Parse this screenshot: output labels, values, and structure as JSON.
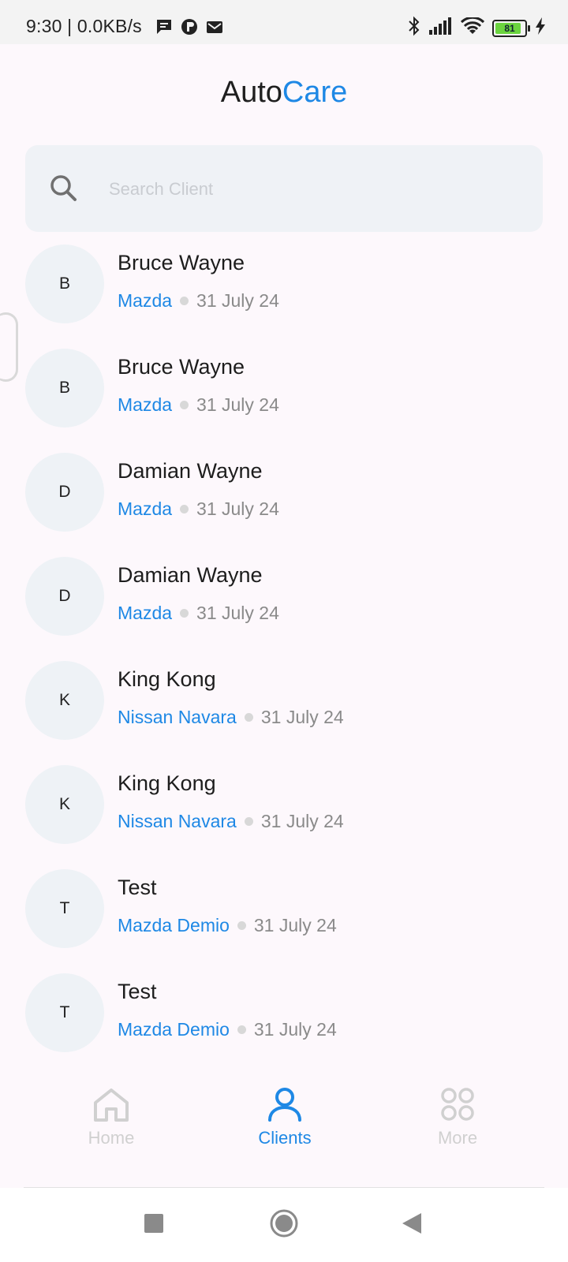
{
  "status_bar": {
    "time": "9:30 | 0.0KB/s",
    "battery": "81",
    "icons": [
      "message-icon",
      "app-icon",
      "mail-icon",
      "bluetooth-icon",
      "signal-icon",
      "wifi-icon",
      "battery-icon",
      "charging-icon"
    ]
  },
  "header": {
    "title_part1": "Auto",
    "title_part2": "Care"
  },
  "search": {
    "placeholder": "Search Client",
    "value": ""
  },
  "clients": [
    {
      "initial": "B",
      "name": "Bruce Wayne",
      "model": "Mazda",
      "date": "31 July 24"
    },
    {
      "initial": "B",
      "name": "Bruce Wayne",
      "model": "Mazda",
      "date": "31 July 24"
    },
    {
      "initial": "D",
      "name": "Damian Wayne",
      "model": "Mazda",
      "date": "31 July 24"
    },
    {
      "initial": "D",
      "name": "Damian Wayne",
      "model": "Mazda",
      "date": "31 July 24"
    },
    {
      "initial": "K",
      "name": "King Kong",
      "model": "Nissan Navara",
      "date": "31 July 24"
    },
    {
      "initial": "K",
      "name": "King Kong",
      "model": "Nissan Navara",
      "date": "31 July 24"
    },
    {
      "initial": "T",
      "name": "Test",
      "model": "Mazda Demio",
      "date": "31 July 24"
    },
    {
      "initial": "T",
      "name": "Test",
      "model": "Mazda Demio",
      "date": "31 July 24"
    }
  ],
  "bottom_nav": {
    "home": "Home",
    "clients": "Clients",
    "more": "More",
    "active": "clients"
  },
  "colors": {
    "accent": "#1e88e5",
    "background": "#fdf8fc",
    "avatar_bg": "#eef2f6"
  }
}
